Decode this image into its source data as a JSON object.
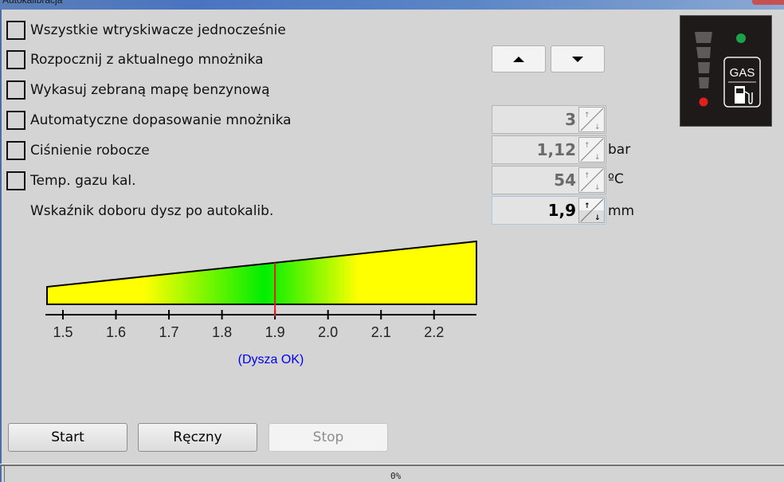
{
  "window": {
    "title": "Autokalibracja"
  },
  "options": [
    {
      "label": "Wszystkie wtryskiwacze jednocześnie",
      "checked": false
    },
    {
      "label": "Rozpocznij z aktualnego mnożnika",
      "checked": false
    },
    {
      "label": "Wykasuj zebraną mapę benzynową",
      "checked": false
    },
    {
      "label": "Automatyczne dopasowanie mnożnika",
      "checked": false
    },
    {
      "label": "Ciśnienie robocze",
      "checked": false
    },
    {
      "label": "Temp. gazu kal.",
      "checked": false
    }
  ],
  "nozzle_indicator_label": "Wskaźnik doboru dysz po autokalib.",
  "arrows": {
    "up_icon": "triangle-up",
    "down_icon": "triangle-down"
  },
  "fields": {
    "multiplier": {
      "value": "3",
      "unit": ""
    },
    "pressure": {
      "value": "1,12",
      "unit": "bar"
    },
    "gas_temp": {
      "value": "54",
      "unit": "ºC"
    },
    "nozzle": {
      "value": "1,9",
      "unit": "mm"
    }
  },
  "gas_panel": {
    "label": "GAS",
    "level_segments": 4,
    "status_led_color": "#1aa34a",
    "reserve_led_color": "#e02020"
  },
  "chart_data": {
    "type": "gauge",
    "title": "",
    "xlabel": "",
    "ticks": [
      "1.5",
      "1.6",
      "1.7",
      "1.8",
      "1.9",
      "2.0",
      "2.1",
      "2.2"
    ],
    "tick_values": [
      1.5,
      1.6,
      1.7,
      1.8,
      1.9,
      2.0,
      2.1,
      2.2
    ],
    "xlim": [
      1.47,
      2.28
    ],
    "marker_value": 1.9,
    "marker_color": "#e02020",
    "optimal_value": 1.88,
    "gradient_colors": {
      "ok": "#00ee00",
      "warn": "#ffff00"
    },
    "status_text": "(Dysza OK)",
    "status_color": "#0000ee"
  },
  "buttons": {
    "start": "Start",
    "manual": "Ręczny",
    "stop": "Stop"
  },
  "progress": {
    "value": 0,
    "label": "0%"
  }
}
